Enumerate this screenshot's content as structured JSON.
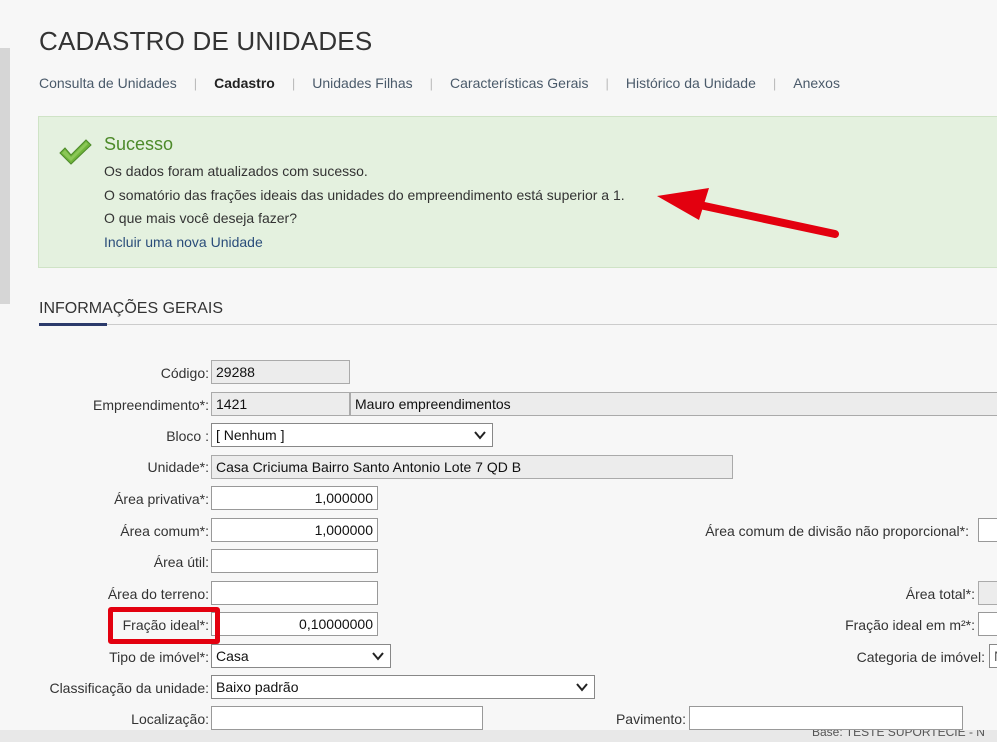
{
  "page": {
    "title": "CADASTRO DE UNIDADES",
    "tabs": [
      "Consulta de Unidades",
      "Cadastro",
      "Unidades Filhas",
      "Características Gerais",
      "Histórico da Unidade",
      "Anexos"
    ],
    "active_tab": "Cadastro"
  },
  "alert": {
    "title": "Sucesso",
    "line1": "Os dados foram atualizados com sucesso.",
    "line2": "O somatório das frações ideais das unidades do empreendimento está superior a 1.",
    "line3": "O que mais você deseja fazer?",
    "link": "Incluir uma nova Unidade",
    "success_color": "#4d8a2a",
    "arrow_color": "#e3000f"
  },
  "section": {
    "title": "INFORMAÇÕES GERAIS"
  },
  "form": {
    "codigo": {
      "label": "Código:",
      "value": "29288"
    },
    "empreendimento": {
      "label": "Empreendimento*:",
      "code": "1421",
      "name": "Mauro empreendimentos"
    },
    "bloco": {
      "label": "Bloco :",
      "value": "[ Nenhum ]"
    },
    "unidade": {
      "label": "Unidade*:",
      "value": "Casa Criciuma Bairro Santo Antonio Lote 7 QD B"
    },
    "area_privativa": {
      "label": "Área privativa*:",
      "value": "1,000000"
    },
    "area_comum": {
      "label": "Área comum*:",
      "value": "1,000000"
    },
    "area_comum_div": {
      "label": "Área comum de divisão não proporcional*:"
    },
    "area_util": {
      "label": "Área útil:",
      "value": ""
    },
    "area_terreno": {
      "label": "Área do terreno:",
      "value": ""
    },
    "area_total": {
      "label": "Área total*:"
    },
    "fracao_ideal": {
      "label": "Fração ideal*:",
      "value": "0,10000000"
    },
    "fracao_ideal_m2": {
      "label": "Fração ideal em m²*:"
    },
    "tipo_imovel": {
      "label": "Tipo de imóvel*:",
      "value": "Casa"
    },
    "categoria_imovel": {
      "label": "Categoria de imóvel:",
      "value": "N"
    },
    "classificacao": {
      "label": "Classificação da unidade:",
      "value": "Baixo padrão"
    },
    "localizacao": {
      "label": "Localização:",
      "value": ""
    },
    "pavimento": {
      "label": "Pavimento:",
      "value": ""
    }
  },
  "footer": {
    "text": "Base: TESTE SUPORTECIE - N"
  }
}
